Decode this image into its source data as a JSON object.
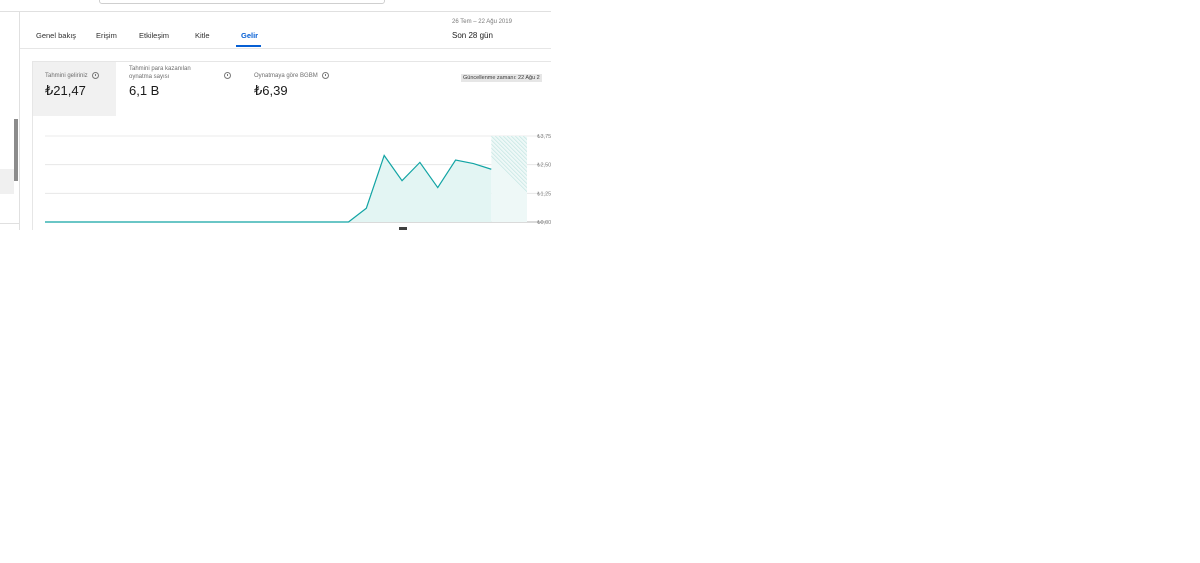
{
  "tabs": [
    {
      "label": "Genel bakış",
      "active": false
    },
    {
      "label": "Erişim",
      "active": false
    },
    {
      "label": "Etkileşim",
      "active": false
    },
    {
      "label": "Kitle",
      "active": false
    },
    {
      "label": "Gelir",
      "active": true
    }
  ],
  "date_range": {
    "range": "26 Tem – 22 Ağu 2019",
    "label": "Son 28 gün"
  },
  "metrics": [
    {
      "title": "Tahmini geliriniz",
      "value": "₺21,47",
      "icon": "info-icon"
    },
    {
      "title": "Tahmini para kazanılan\noynatma sayısı",
      "value": "6,1 B",
      "icon": "info-icon"
    },
    {
      "title": "Oynatmaya göre BGBM",
      "value": "₺6,39",
      "icon": "info-icon"
    }
  ],
  "updated_text": "Güncellenme zamanı: 22 Ağu 2",
  "colors": {
    "accent": "#065fd4",
    "line": "#12a4a4",
    "fill": "#e3f5f3"
  },
  "chart_data": {
    "type": "area",
    "x": [
      1,
      2,
      3,
      4,
      5,
      6,
      7,
      8,
      9,
      10,
      11,
      12,
      13,
      14,
      15,
      16,
      17,
      18,
      19,
      20,
      21,
      22,
      23,
      24,
      25,
      26,
      27,
      28
    ],
    "values": [
      0,
      0,
      0,
      0,
      0,
      0,
      0,
      0,
      0,
      0,
      0,
      0,
      0,
      0,
      0,
      0,
      0,
      0,
      0.6,
      2.9,
      1.8,
      2.6,
      1.5,
      2.7,
      2.55,
      2.3,
      2.3,
      2.3
    ],
    "y_ticks": [
      "₺3,75",
      "₺2,50",
      "₺1,25",
      "₺0,00"
    ],
    "ylim": [
      0,
      3.75
    ],
    "grid": true,
    "partial_from_index": 26
  }
}
